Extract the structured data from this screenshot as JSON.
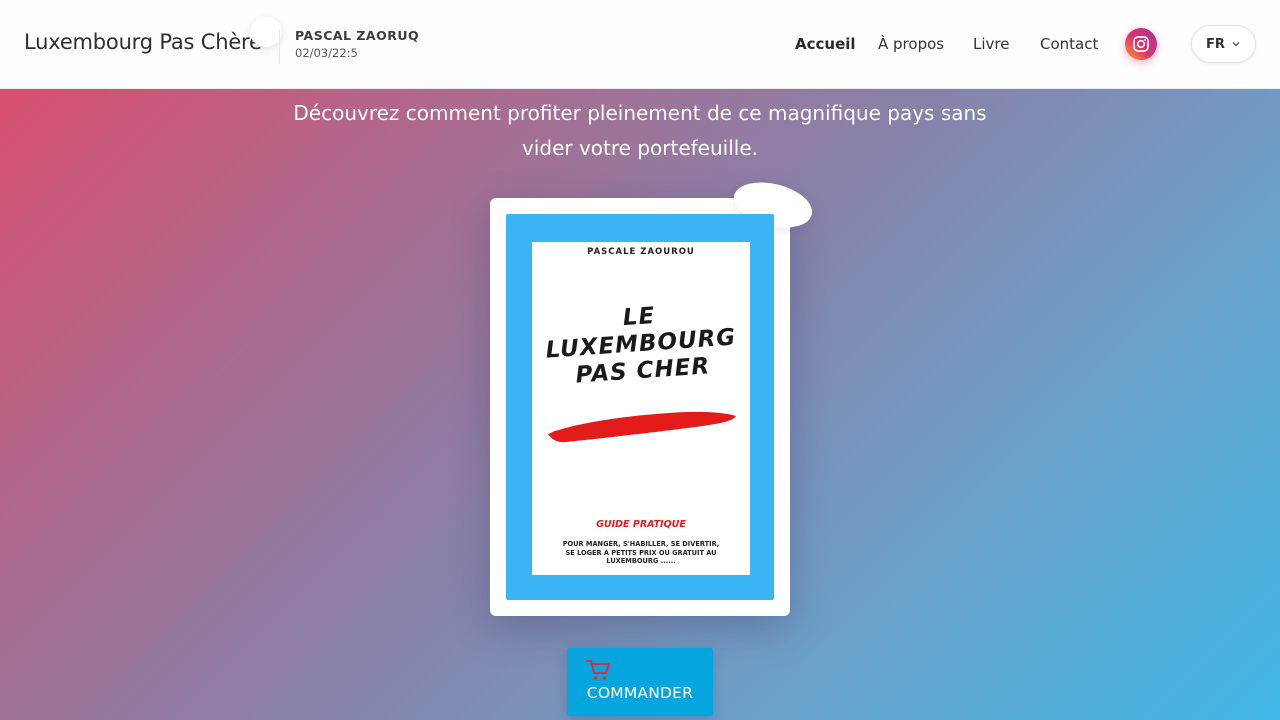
{
  "header": {
    "brand": "Luxembourg Pas Chère",
    "author_name": "PASCAL ZAORUQ",
    "author_date": "02/03/22:5",
    "nav": [
      {
        "label": "Accueil",
        "active": true
      },
      {
        "label": "À propos",
        "active": false
      },
      {
        "label": "Livre",
        "active": false
      },
      {
        "label": "Contact",
        "active": false
      }
    ],
    "social_icon": "instagram-icon",
    "language": "FR",
    "language_icon": "chevron-down-icon"
  },
  "hero": {
    "tagline_line1": "Découvrez comment profiter pleinement de ce magnifique pays sans",
    "tagline_line2": "vider votre portefeuille."
  },
  "book": {
    "cover_author": "PASCALE ZAOUROU",
    "cover_title_line1": "LE",
    "cover_title_line2": "LUXEMBOURG",
    "cover_title_line3": "PAS CHER",
    "cover_guide": "GUIDE PRATIQUE",
    "cover_desc_line1": "POUR MANGER, S'HABILLER, SE DIVERTIR,",
    "cover_desc_line2": "SE LOGER À PETITS PRIX OU GRATUIT AU",
    "cover_desc_line3": "LUXEMBOURG ......",
    "frame_color": "#3bb4f6",
    "stroke_color": "#e41b1b"
  },
  "order": {
    "label": "COMMANDER",
    "icon": "cart-icon",
    "color": "#05a5e0"
  }
}
